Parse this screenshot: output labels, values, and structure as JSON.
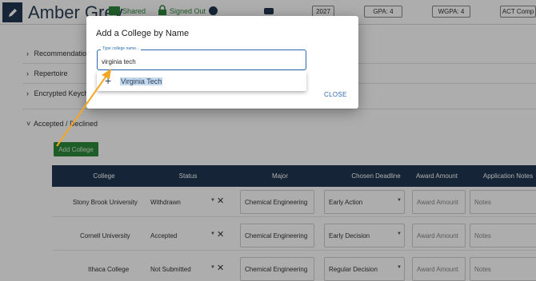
{
  "header": {
    "student_name": "Amber Grey",
    "shared_label": "Shared",
    "signed_out_label": "Signed Out",
    "class_year": "2027",
    "gpa": "GPA: 4",
    "wgpa": "WGPA: 4",
    "act": "ACT Comp"
  },
  "sections": {
    "recommendations": "Recommendations",
    "repertoire": "Repertoire",
    "encrypted_keychain": "Encrypted Keychain",
    "accepted_declined": "Accepted / Declined"
  },
  "add_college_button": "Add College",
  "table": {
    "columns": [
      "College",
      "Status",
      "Major",
      "Chosen Deadline",
      "Award Amount",
      "Application Notes"
    ],
    "rows": [
      {
        "college": "Stony Brook University",
        "status": "Withdrawn",
        "major": "Chemical Engineering",
        "deadline": "Early Action",
        "award_placeholder": "Award Amount",
        "notes_placeholder": "Notes"
      },
      {
        "college": "Cornell University",
        "status": "Accepted",
        "major": "Chemical Engineering",
        "deadline": "Early Decision",
        "award_placeholder": "Award Amount",
        "notes_placeholder": "Notes"
      },
      {
        "college": "Ithaca College",
        "status": "Not Submitted",
        "major": "Chemical Engineering",
        "deadline": "Regular Decision",
        "award_placeholder": "Award Amount",
        "notes_placeholder": "Notes"
      }
    ]
  },
  "dialog": {
    "title": "Add a College by Name",
    "input_label": "Type college name...",
    "input_value": "virginia tech",
    "suggestion": "Virginia Tech",
    "close_label": "CLOSE"
  },
  "colors": {
    "navy": "#1f3650",
    "green": "#2f8a3c",
    "accent_blue": "#2a6bb0",
    "annotation_orange": "#f5a623"
  }
}
